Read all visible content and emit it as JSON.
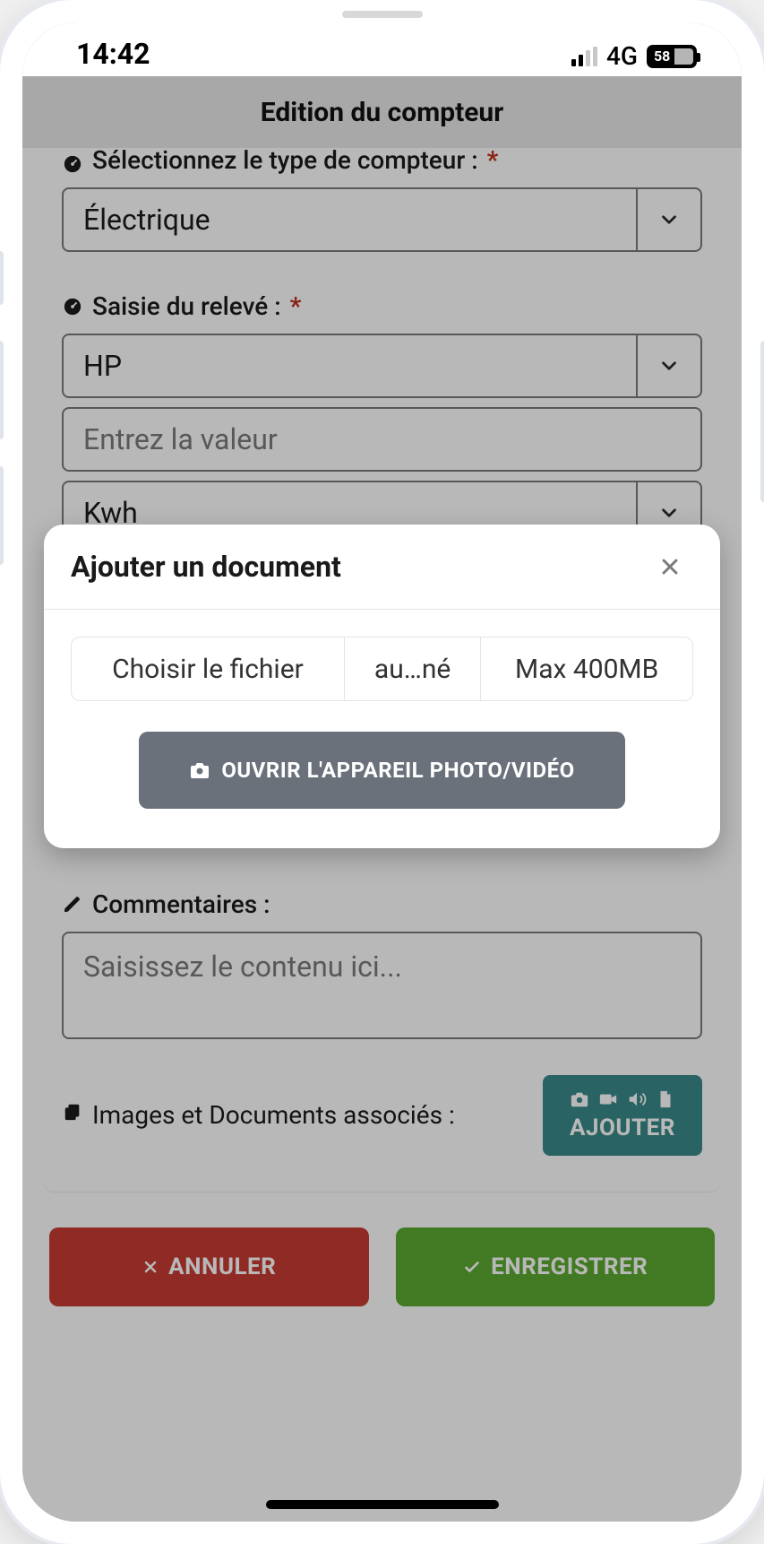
{
  "status": {
    "time": "14:42",
    "network_label": "4G",
    "battery_text": "58"
  },
  "app": {
    "title": "Edition du compteur"
  },
  "form": {
    "type_label": "Sélectionnez le type de compteur :",
    "type_value": "Électrique",
    "reading_label": "Saisie du relevé :",
    "reading_value": "HP",
    "value_placeholder": "Entrez la valeur",
    "unit_value": "Kwh",
    "comments_label": "Commentaires :",
    "comments_placeholder": "Saisissez le contenu ici...",
    "images_label": "Images et Documents associés :",
    "add_button_label": "AJOUTER"
  },
  "footer": {
    "cancel": "ANNULER",
    "save": "ENREGISTRER"
  },
  "modal": {
    "title": "Ajouter un document",
    "choose_file": "Choisir le fichier",
    "filename": "au…né",
    "max_size": "Max 400MB",
    "camera_button": "OUVRIR L'APPAREIL PHOTO/VIDÉO"
  }
}
